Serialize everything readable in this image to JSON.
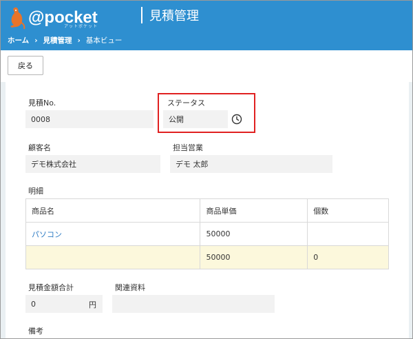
{
  "header": {
    "logo_text": "@pocket",
    "logo_sub": "アットポケット",
    "title": "見積管理",
    "bg_color": "#2e8fd0"
  },
  "breadcrumb": {
    "home": "ホーム",
    "sep1": "›",
    "estimates": "見積管理",
    "sep2": "›",
    "current": "基本ビュー"
  },
  "toolbar": {
    "back_label": "戻る"
  },
  "form": {
    "estimate_no_label": "見積No.",
    "estimate_no_value": "0008",
    "status_label": "ステータス",
    "status_value": "公開",
    "customer_label": "顧客名",
    "customer_value": "デモ株式会社",
    "sales_label": "担当営業",
    "sales_value": "デモ 太郎",
    "detail_label": "明細",
    "total_label": "見積金額合計",
    "total_value": "0",
    "total_unit": "円",
    "related_label": "関連資料",
    "related_value": "",
    "remarks_label": "備考"
  },
  "table": {
    "headers": [
      "商品名",
      "商品単価",
      "個数"
    ],
    "rows": [
      [
        "パソコン",
        "50000",
        ""
      ]
    ],
    "total_row": [
      "",
      "50000",
      "0"
    ]
  },
  "colors": {
    "accent": "#2e8fd0",
    "link": "#2e7cc4",
    "highlight_border": "#e02020",
    "total_row_bg": "#fcf8dc",
    "field_bg": "#f2f2f2"
  },
  "icons": {
    "status_history": "clock-icon",
    "logo": "kangaroo-logo-icon"
  }
}
